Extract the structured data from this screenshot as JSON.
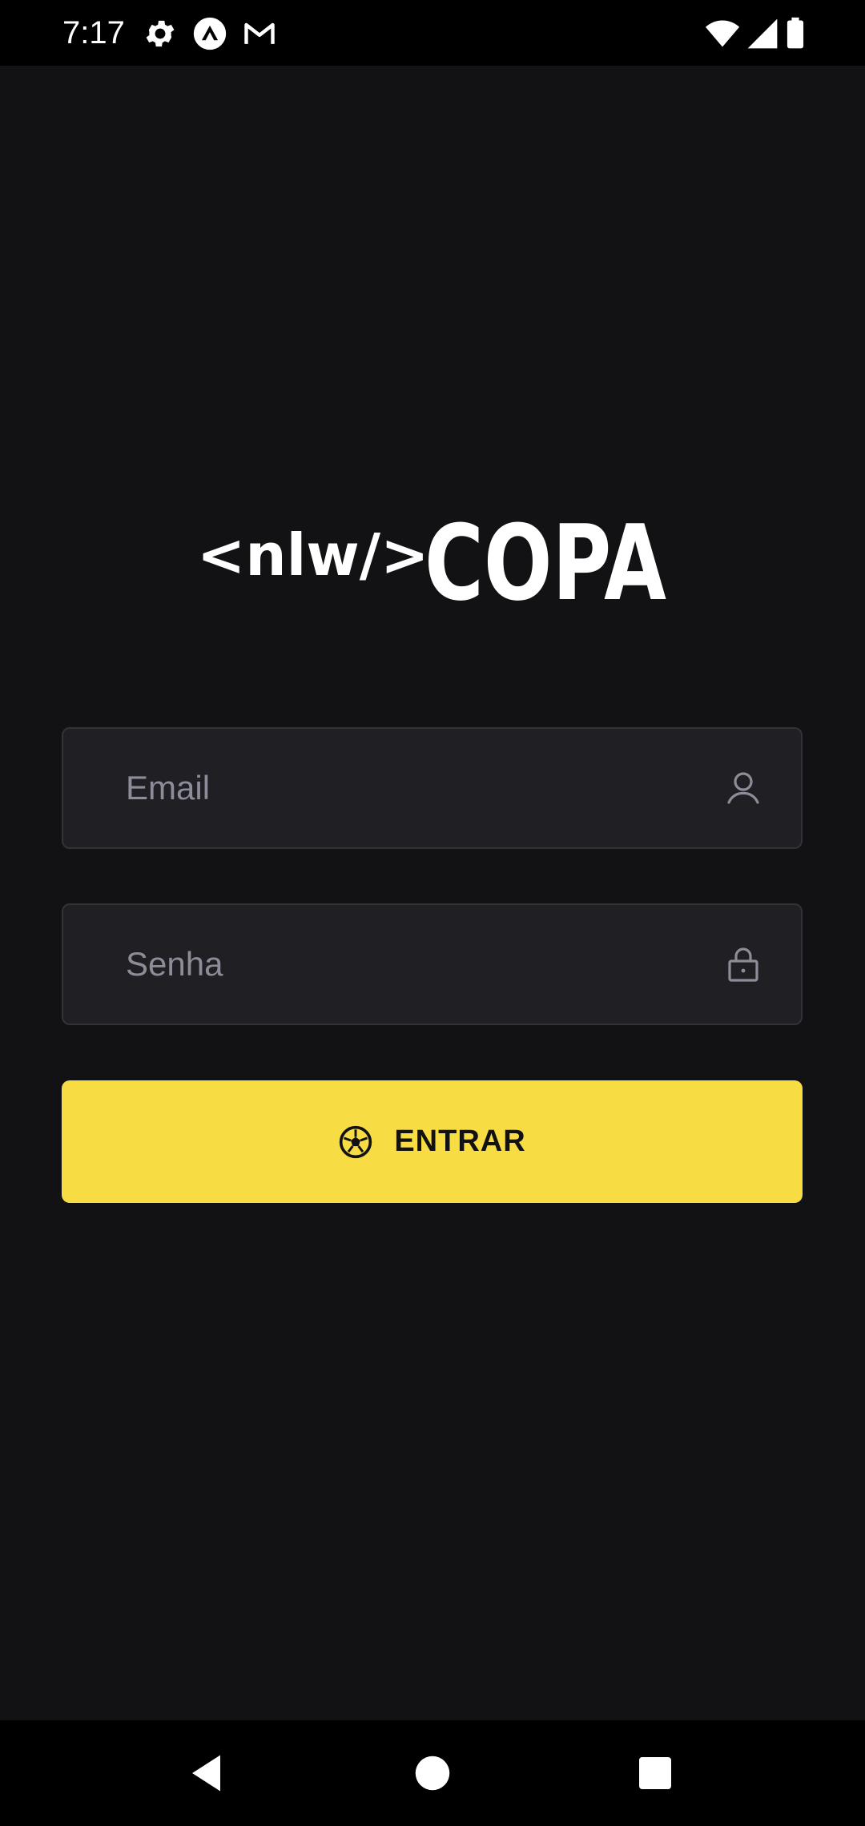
{
  "status_bar": {
    "time": "7:17",
    "icons": [
      "gear-icon",
      "expo-icon",
      "gmail-icon",
      "wifi-icon",
      "signal-icon",
      "battery-icon"
    ]
  },
  "logo": {
    "prefix": "<nlw/>",
    "name": "COPA"
  },
  "form": {
    "email": {
      "placeholder": "Email",
      "value": "",
      "icon": "user-icon"
    },
    "password": {
      "placeholder": "Senha",
      "value": "",
      "icon": "lock-icon"
    },
    "submit": {
      "label": "ENTRAR",
      "icon": "soccer-ball-icon"
    }
  },
  "colors": {
    "background": "#121214",
    "input_background": "#202024",
    "input_border": "#323238",
    "placeholder": "#8d8d99",
    "accent": "#f7dd43",
    "button_text": "#121214"
  },
  "nav_bar": {
    "buttons": [
      "back-icon",
      "home-icon",
      "recents-icon"
    ]
  }
}
